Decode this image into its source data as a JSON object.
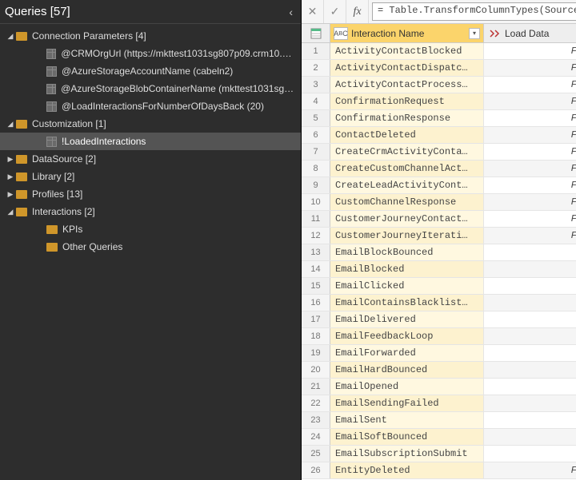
{
  "sidebar": {
    "title": "Queries [57]",
    "groups": [
      {
        "label": "Connection Parameters [4]",
        "expanded": true,
        "items": [
          {
            "label": "@CRMOrgUrl (https://mkttest1031sg807p09.crm10.dy…",
            "type": "table"
          },
          {
            "label": "@AzureStorageAccountName (cabeln2)",
            "type": "table"
          },
          {
            "label": "@AzureStorageBlobContainerName (mkttest1031sg80…",
            "type": "table"
          },
          {
            "label": "@LoadInteractionsForNumberOfDaysBack (20)",
            "type": "table"
          }
        ]
      },
      {
        "label": "Customization [1]",
        "expanded": true,
        "items": [
          {
            "label": "!LoadedInteractions",
            "type": "table",
            "selected": true
          }
        ]
      },
      {
        "label": "DataSource [2]",
        "expanded": false
      },
      {
        "label": "Library [2]",
        "expanded": false
      },
      {
        "label": "Profiles [13]",
        "expanded": false
      },
      {
        "label": "Interactions [2]",
        "expanded": true,
        "items": [
          {
            "label": "KPIs",
            "type": "folder"
          },
          {
            "label": "Other Queries",
            "type": "folder"
          }
        ]
      }
    ]
  },
  "formula": "= Table.TransformColumnTypes(Source,{{",
  "columns": [
    {
      "name": "Interaction Name",
      "type": "ABC",
      "selected": true
    },
    {
      "name": "Load Data",
      "type": "fx",
      "selected": false
    }
  ],
  "rows": [
    {
      "n": "1",
      "c1": "ActivityContactBlocked",
      "c2": "FALSE"
    },
    {
      "n": "2",
      "c1": "ActivityContactDispatc…",
      "c2": "FALSE"
    },
    {
      "n": "3",
      "c1": "ActivityContactProcess…",
      "c2": "FALSE"
    },
    {
      "n": "4",
      "c1": "ConfirmationRequest",
      "c2": "FALSE"
    },
    {
      "n": "5",
      "c1": "ConfirmationResponse",
      "c2": "FALSE"
    },
    {
      "n": "6",
      "c1": "ContactDeleted",
      "c2": "FALSE"
    },
    {
      "n": "7",
      "c1": "CreateCrmActivityConta…",
      "c2": "FALSE"
    },
    {
      "n": "8",
      "c1": "CreateCustomChannelAct…",
      "c2": "FALSE"
    },
    {
      "n": "9",
      "c1": "CreateLeadActivityCont…",
      "c2": "FALSE"
    },
    {
      "n": "10",
      "c1": "CustomChannelResponse",
      "c2": "FALSE"
    },
    {
      "n": "11",
      "c1": "CustomerJourneyContact…",
      "c2": "FALSE"
    },
    {
      "n": "12",
      "c1": "CustomerJourneyIterati…",
      "c2": "FALSE"
    },
    {
      "n": "13",
      "c1": "EmailBlockBounced",
      "c2": "TRUE"
    },
    {
      "n": "14",
      "c1": "EmailBlocked",
      "c2": "TRUE"
    },
    {
      "n": "15",
      "c1": "EmailClicked",
      "c2": "TRUE"
    },
    {
      "n": "16",
      "c1": "EmailContainsBlacklist…",
      "c2": "TRUE"
    },
    {
      "n": "17",
      "c1": "EmailDelivered",
      "c2": "TRUE"
    },
    {
      "n": "18",
      "c1": "EmailFeedbackLoop",
      "c2": "TRUE"
    },
    {
      "n": "19",
      "c1": "EmailForwarded",
      "c2": "TRUE"
    },
    {
      "n": "20",
      "c1": "EmailHardBounced",
      "c2": "TRUE"
    },
    {
      "n": "21",
      "c1": "EmailOpened",
      "c2": "TRUE"
    },
    {
      "n": "22",
      "c1": "EmailSendingFailed",
      "c2": "TRUE"
    },
    {
      "n": "23",
      "c1": "EmailSent",
      "c2": "TRUE"
    },
    {
      "n": "24",
      "c1": "EmailSoftBounced",
      "c2": "TRUE"
    },
    {
      "n": "25",
      "c1": "EmailSubscriptionSubmit",
      "c2": "TRUE"
    },
    {
      "n": "26",
      "c1": "EntityDeleted",
      "c2": "FALSE"
    }
  ]
}
